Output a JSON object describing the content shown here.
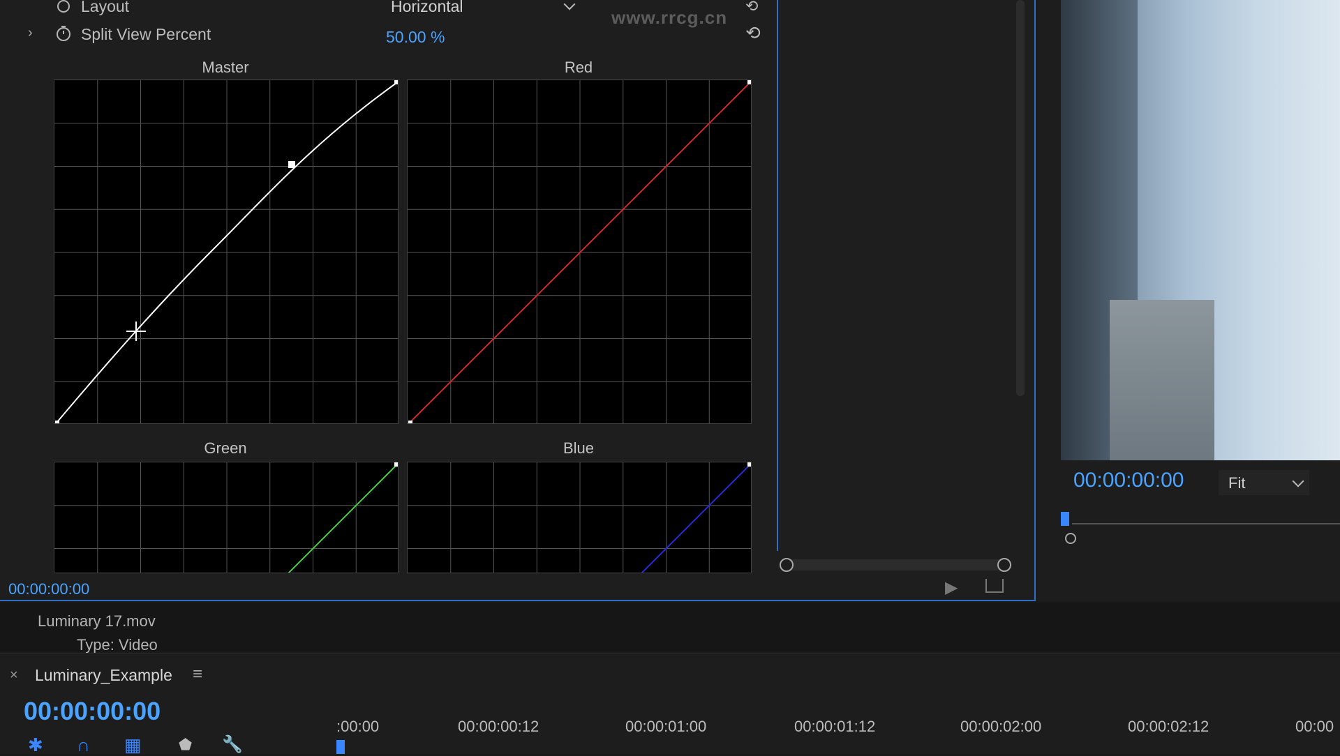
{
  "effect_controls": {
    "layout_label": "Layout",
    "layout_value": "Horizontal",
    "split_view_label": "Split View Percent",
    "split_view_value": "50.00 %",
    "curves": {
      "master_title": "Master",
      "red_title": "Red",
      "green_title": "Green",
      "blue_title": "Blue"
    },
    "timecode": "00:00:00:00",
    "colors": {
      "master": "#ffffff",
      "red": "#d12a2a",
      "green": "#3fcf3f",
      "blue": "#2a2ad6",
      "accent": "#4aa3ff"
    }
  },
  "watermark_text": "www.rrcg.cn",
  "program_monitor": {
    "timecode": "00:00:00:00",
    "fit_label": "Fit"
  },
  "project_info": {
    "clip_name": "Luminary 17.mov",
    "clip_type": "Type: Video"
  },
  "timeline": {
    "sequence_name": "Luminary_Example",
    "timecode": "00:00:00:00",
    "ruler_labels": [
      ":00:00",
      "00:00:00:12",
      "00:00:01:00",
      "00:00:01:12",
      "00:00:02:00",
      "00:00:02:12",
      "00:00"
    ]
  }
}
